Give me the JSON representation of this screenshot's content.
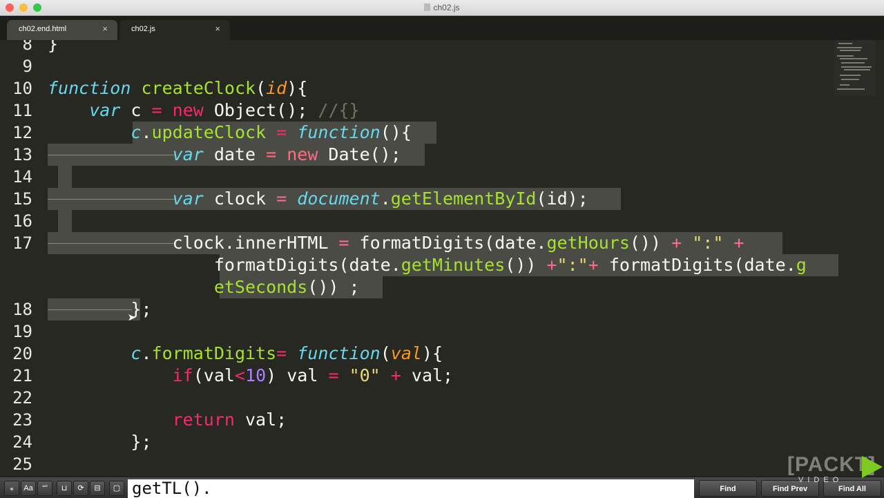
{
  "window": {
    "title": "ch02.js"
  },
  "tabs": [
    {
      "label": "ch02.end.html",
      "close": "×"
    },
    {
      "label": "ch02.js",
      "close": "×"
    }
  ],
  "editor": {
    "line_numbers": [
      "8",
      "9",
      "10",
      "11",
      "12",
      "13",
      "14",
      "15",
      "16",
      "17",
      "18",
      "19",
      "20",
      "21",
      "22",
      "23",
      "24",
      "25"
    ],
    "lines": [
      [
        [
          "}",
          "w"
        ]
      ],
      [],
      [
        [
          "function",
          "k"
        ],
        [
          " ",
          ""
        ],
        [
          "createClock",
          "f"
        ],
        [
          "(",
          ""
        ],
        [
          "id",
          "p"
        ],
        [
          "){",
          ""
        ]
      ],
      [
        [
          "    ",
          ""
        ],
        [
          "var",
          "k"
        ],
        [
          " c ",
          ""
        ],
        [
          "=",
          "o"
        ],
        [
          " ",
          ""
        ],
        [
          "new",
          "r"
        ],
        [
          " Object(); ",
          ""
        ],
        [
          "//{}",
          "c"
        ]
      ],
      [
        [
          "        ",
          ""
        ],
        [
          "c",
          "k"
        ],
        [
          ".",
          ""
        ],
        [
          "updateClock",
          "f"
        ],
        [
          " ",
          ""
        ],
        [
          "=",
          "o"
        ],
        [
          " ",
          ""
        ],
        [
          "function",
          "k"
        ],
        [
          "(){",
          ""
        ]
      ],
      [
        [
          "            ",
          ""
        ],
        [
          "var",
          "k"
        ],
        [
          " date ",
          ""
        ],
        [
          "=",
          "ws"
        ],
        [
          " ",
          ""
        ],
        [
          "new",
          "ws"
        ],
        [
          " Date();",
          ""
        ]
      ],
      [],
      [
        [
          "            ",
          ""
        ],
        [
          "var",
          "k"
        ],
        [
          " clock ",
          ""
        ],
        [
          "=",
          "ws"
        ],
        [
          " ",
          ""
        ],
        [
          "document",
          "k"
        ],
        [
          ".",
          ""
        ],
        [
          "getElementById",
          "f"
        ],
        [
          "(id);",
          ""
        ]
      ],
      [],
      [
        [
          "            clock.innerHTML ",
          ""
        ],
        [
          "=",
          "ws"
        ],
        [
          " formatDigits(date.",
          ""
        ],
        [
          "getHours",
          "f"
        ],
        [
          "()) ",
          ""
        ],
        [
          "+",
          "ws"
        ],
        [
          " ",
          ""
        ],
        [
          "\":\"",
          "s"
        ],
        [
          " ",
          ""
        ],
        [
          "+",
          "ws"
        ]
      ],
      [
        [
          "                formatDigits(date.",
          ""
        ],
        [
          "getMinutes",
          "f"
        ],
        [
          "()) ",
          ""
        ],
        [
          "+",
          "ws"
        ],
        [
          "\":\"",
          "s"
        ],
        [
          "+",
          "ws"
        ],
        [
          " formatDigits(date.",
          ""
        ],
        [
          "g",
          "f"
        ]
      ],
      [
        [
          "                ",
          ""
        ],
        [
          "etSeconds",
          "f"
        ],
        [
          "()) ;",
          ""
        ]
      ],
      [
        [
          "        };",
          ""
        ]
      ],
      [],
      [
        [
          "        ",
          ""
        ],
        [
          "c",
          "k"
        ],
        [
          ".",
          ""
        ],
        [
          "formatDigits",
          "f"
        ],
        [
          "=",
          "o"
        ],
        [
          " ",
          ""
        ],
        [
          "function",
          "k"
        ],
        [
          "(",
          ""
        ],
        [
          "val",
          "p"
        ],
        [
          "){",
          ""
        ]
      ],
      [
        [
          "            ",
          ""
        ],
        [
          "if",
          "r"
        ],
        [
          "(val",
          ""
        ],
        [
          "<",
          "o"
        ],
        [
          "10",
          "n"
        ],
        [
          ") val ",
          ""
        ],
        [
          "=",
          "o"
        ],
        [
          " ",
          ""
        ],
        [
          "\"0\"",
          "s"
        ],
        [
          " ",
          ""
        ],
        [
          "+",
          "o"
        ],
        [
          " val;",
          ""
        ]
      ],
      [],
      [
        [
          "            ",
          ""
        ],
        [
          "return",
          "r"
        ],
        [
          " val;",
          ""
        ]
      ],
      [
        [
          "        };",
          ""
        ]
      ],
      []
    ]
  },
  "find": {
    "options": [
      "⁎",
      "Aa",
      "“”",
      "⊔",
      "⟳",
      "⊟",
      "▢"
    ],
    "query": "getTL().",
    "buttons": {
      "find": "Find",
      "find_prev": "Find Prev",
      "find_all": "Find All"
    }
  },
  "watermark": {
    "brand": "[PACKT]",
    "sub": "VIDEO"
  },
  "colors": {
    "background": "#272822",
    "keyword": "#66d9ef",
    "function": "#a6e22e",
    "parameter": "#fd971f",
    "operator": "#f92672",
    "number": "#ae81ff",
    "string": "#e6db74",
    "comment": "#75715e",
    "selection": "#4a4b45"
  }
}
